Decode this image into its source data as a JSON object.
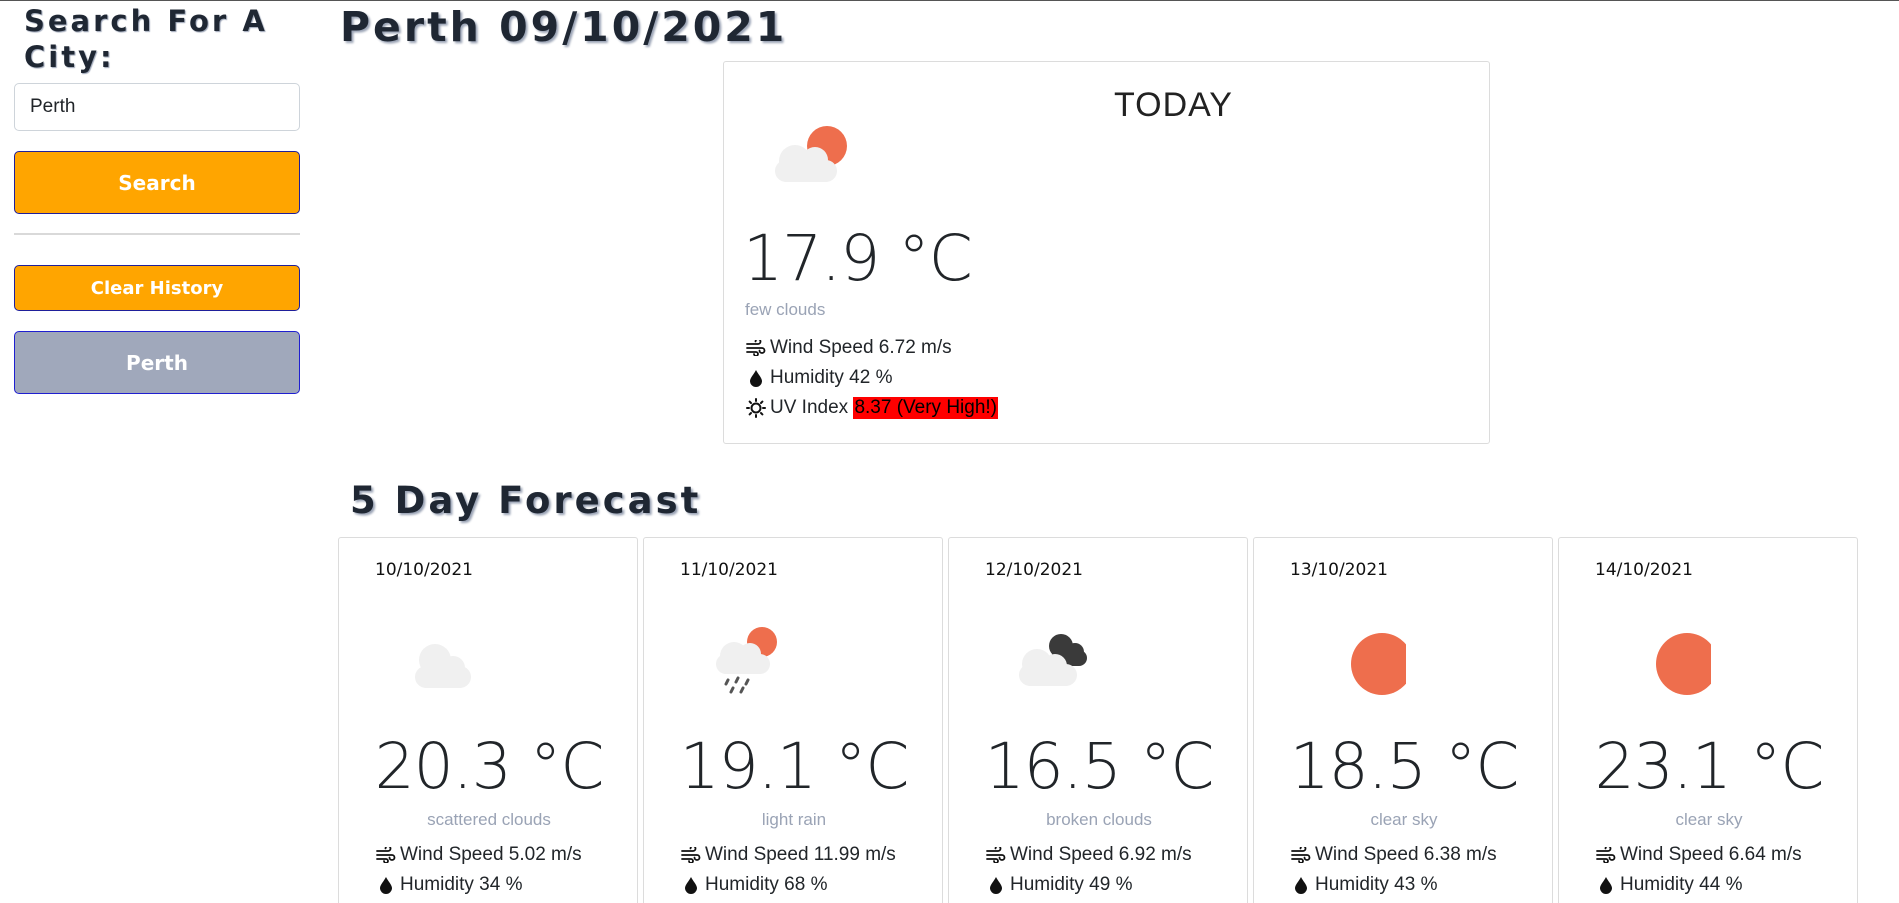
{
  "sidebar": {
    "heading": "Search For A City:",
    "search_value": "Perth",
    "search_label": "Search",
    "clear_label": "Clear History",
    "history": [
      "Perth"
    ]
  },
  "current": {
    "title": "Perth 09/10/2021",
    "today_label": "TODAY",
    "icon": "few-clouds-icon",
    "temp": "17.9 °C",
    "description": "few clouds",
    "wind": "Wind Speed 6.72 m/s",
    "humidity": "Humidity 42 %",
    "uv_label": "UV Index",
    "uv_value": "8.37 (Very High!)",
    "uv_color": "#ff0000"
  },
  "forecast": {
    "title": "5 Day Forecast",
    "days": [
      {
        "date": "10/10/2021",
        "icon": "scattered-clouds-icon",
        "temp": "20.3 °C",
        "description": "scattered clouds",
        "wind": "Wind Speed 5.02 m/s",
        "humidity": "Humidity 34 %"
      },
      {
        "date": "11/10/2021",
        "icon": "light-rain-icon",
        "temp": "19.1 °C",
        "description": "light rain",
        "wind": "Wind Speed 11.99 m/s",
        "humidity": "Humidity 68 %"
      },
      {
        "date": "12/10/2021",
        "icon": "broken-clouds-icon",
        "temp": "16.5 °C",
        "description": "broken clouds",
        "wind": "Wind Speed 6.92 m/s",
        "humidity": "Humidity 49 %"
      },
      {
        "date": "13/10/2021",
        "icon": "clear-sky-icon",
        "temp": "18.5 °C",
        "description": "clear sky",
        "wind": "Wind Speed 6.38 m/s",
        "humidity": "Humidity 43 %"
      },
      {
        "date": "14/10/2021",
        "icon": "clear-sky-icon",
        "temp": "23.1 °C",
        "description": "clear sky",
        "wind": "Wind Speed 6.64 m/s",
        "humidity": "Humidity 44 %"
      }
    ]
  },
  "colors": {
    "button_primary": "#ffa500",
    "button_history": "#a0a8bb",
    "sun": "#ee6e4d",
    "cloud": "#f0f0f0",
    "dark_cloud": "#3a3a3a"
  }
}
